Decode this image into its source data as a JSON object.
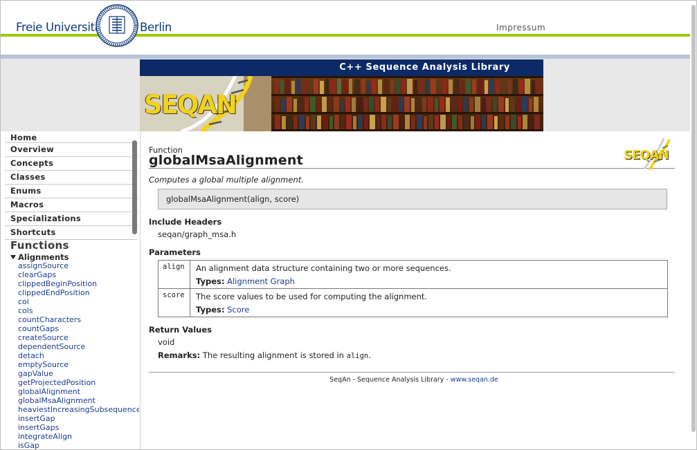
{
  "header": {
    "brand_left": "Freie Universität",
    "brand_right": "Berlin",
    "impressum": "Impressum"
  },
  "banner": {
    "title": "C++ Sequence Analysis Library",
    "logo_text": "SEQAN"
  },
  "sidebar": {
    "nav": [
      {
        "label": "Home"
      },
      {
        "label": "Overview"
      },
      {
        "label": "Concepts"
      },
      {
        "label": "Classes"
      },
      {
        "label": "Enums"
      },
      {
        "label": "Macros"
      },
      {
        "label": "Specializations"
      },
      {
        "label": "Shortcuts"
      }
    ],
    "functions_heading": "Functions",
    "group_label": "Alignments",
    "functions": [
      "assignSource",
      "clearGaps",
      "clippedBeginPosition",
      "clippedEndPosition",
      "col",
      "cols",
      "countCharacters",
      "countGaps",
      "createSource",
      "dependentSource",
      "detach",
      "emptySource",
      "gapValue",
      "getProjectedPosition",
      "globalAlignment",
      "globalMsaAlignment",
      "heaviestIncreasingSubsequence",
      "insertGap",
      "insertGaps",
      "integrateAlign",
      "isGap"
    ]
  },
  "main": {
    "kind": "Function",
    "title": "globalMsaAlignment",
    "summary": "Computes a global multiple alignment.",
    "signature": "globalMsaAlignment(align, score)",
    "include_heading": "Include Headers",
    "include_value": "seqan/graph_msa.h",
    "params_heading": "Parameters",
    "params": [
      {
        "name": "align",
        "description": "An alignment data structure containing two or more sequences.",
        "types_label": "Types:",
        "type_link": "Alignment Graph"
      },
      {
        "name": "score",
        "description": "The score values to be used for computing the alignment.",
        "types_label": "Types:",
        "type_link": "Score"
      }
    ],
    "return_heading": "Return Values",
    "return_value": "void",
    "remarks_label": "Remarks:",
    "remarks_text": "The resulting alignment is stored in",
    "remarks_code": "align",
    "remarks_end": ".",
    "logo_text": "SEQAN"
  },
  "footer": {
    "text": "SeqAn - Sequence Analysis Library - ",
    "link": "www.seqan.de"
  },
  "colors": {
    "fu_blue": "#0d3a7a",
    "fu_green": "#99cc00",
    "banner_navy": "#0b2a66",
    "seqan_yellow": "#f2d21a",
    "link_blue": "#1a3d8f"
  }
}
